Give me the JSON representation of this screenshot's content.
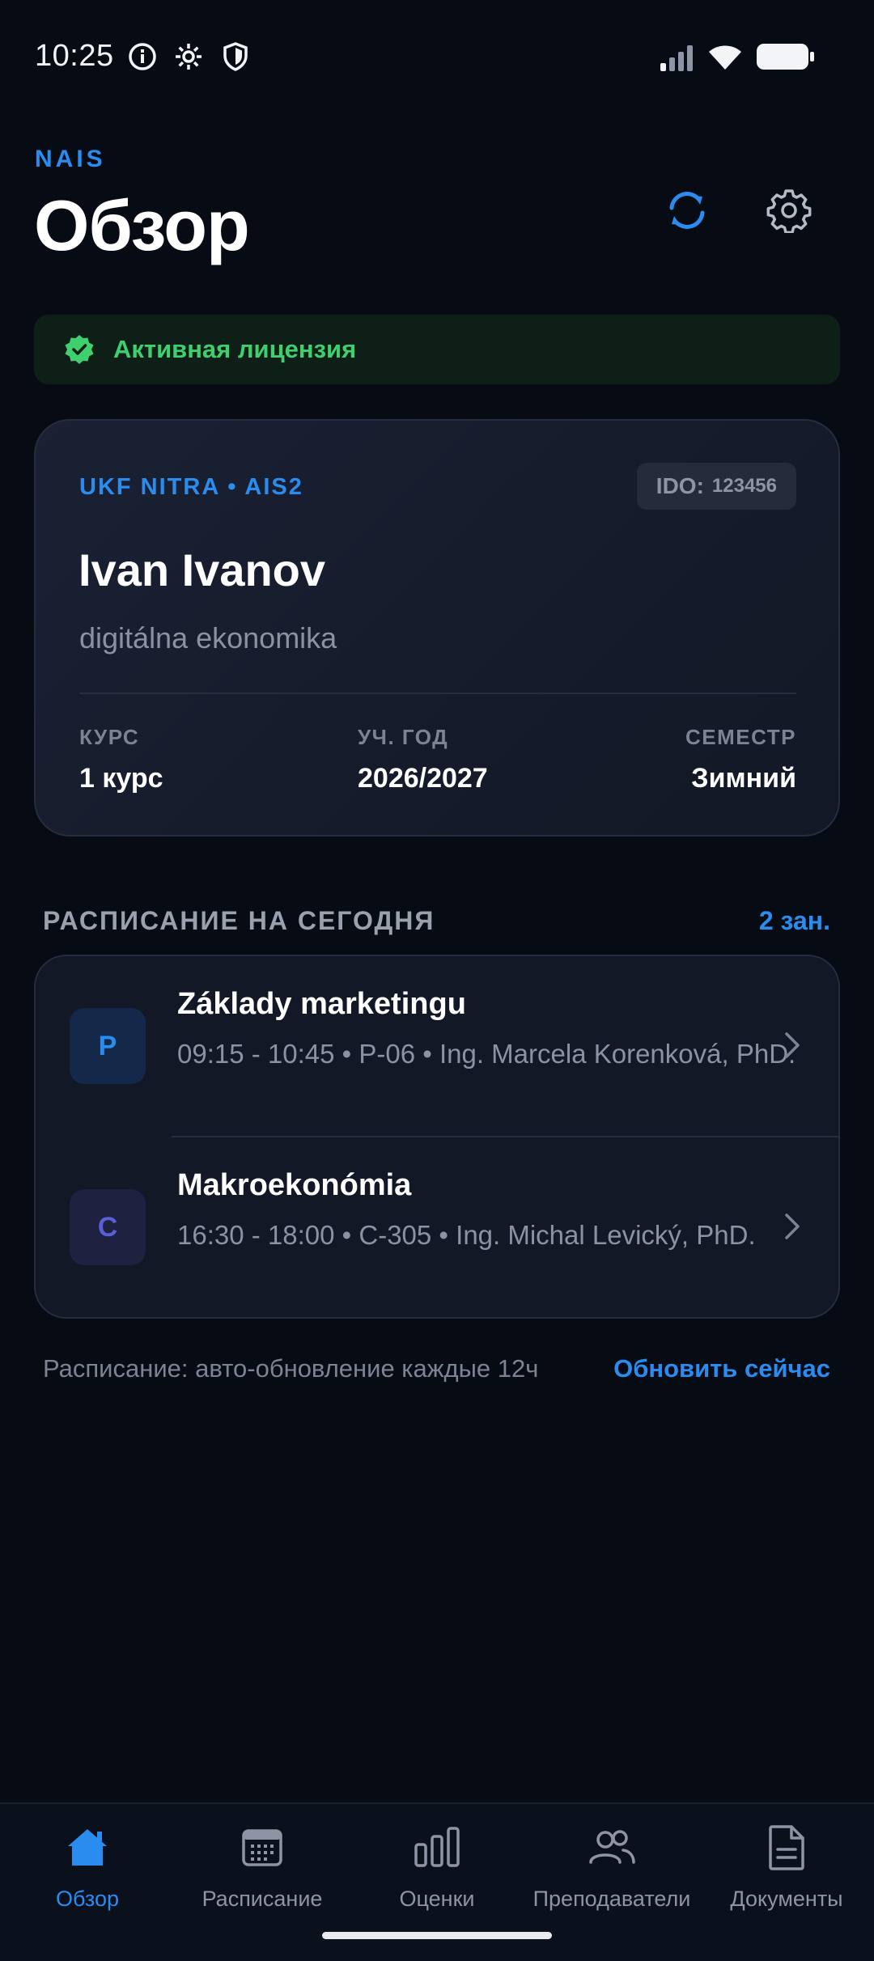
{
  "status_bar": {
    "time": "10:25",
    "icons": [
      "info-icon",
      "settings-gear-icon",
      "shield-icon",
      "signal-icon",
      "wifi-icon",
      "battery-icon"
    ]
  },
  "header": {
    "brand": "NAIS",
    "title": "Обзор",
    "actions": [
      "sync-icon",
      "gear-icon"
    ]
  },
  "license": {
    "text": "Активная лицензия",
    "color": "#3fcf6f"
  },
  "profile": {
    "university": "UKF NITRA • AIS2",
    "ido_label": "IDO:",
    "ido_value": "123456",
    "name": "Ivan Ivanov",
    "program": "digitálna ekonomika",
    "fields": [
      {
        "label": "КУРС",
        "value": "1 курс"
      },
      {
        "label": "УЧ. ГОД",
        "value": "2026/2027"
      },
      {
        "label": "СЕМЕСТР",
        "value": "Зимний"
      }
    ]
  },
  "schedule": {
    "title": "РАСПИСАНИЕ НА СЕГОДНЯ",
    "count": "2 зан.",
    "lessons": [
      {
        "letter": "P",
        "title": "Základy marketingu",
        "meta": "09:15 - 10:45 • P-06 • Ing. Marcela Korenková, PhD.",
        "avatar_bg": "#14284a",
        "avatar_fg": "#2b8cf0"
      },
      {
        "letter": "C",
        "title": "Makroekonómia",
        "meta": "16:30 - 18:00 • C-305 • Ing. Michal Levický, PhD.",
        "avatar_bg": "#1e2140",
        "avatar_fg": "#5b5fd6"
      }
    ],
    "footer_note": "Расписание: авто-обновление каждые 12ч",
    "footer_action": "Обновить сейчас"
  },
  "nav": {
    "items": [
      {
        "label": "Обзор",
        "icon": "home-icon",
        "active": true
      },
      {
        "label": "Расписание",
        "icon": "calendar-icon",
        "active": false
      },
      {
        "label": "Оценки",
        "icon": "bar-chart-icon",
        "active": false
      },
      {
        "label": "Преподаватели",
        "icon": "people-icon",
        "active": false
      },
      {
        "label": "Документы",
        "icon": "document-icon",
        "active": false
      }
    ]
  },
  "colors": {
    "accent": "#2b8cf0",
    "background": "#070b14",
    "success": "#3fcf6f"
  }
}
